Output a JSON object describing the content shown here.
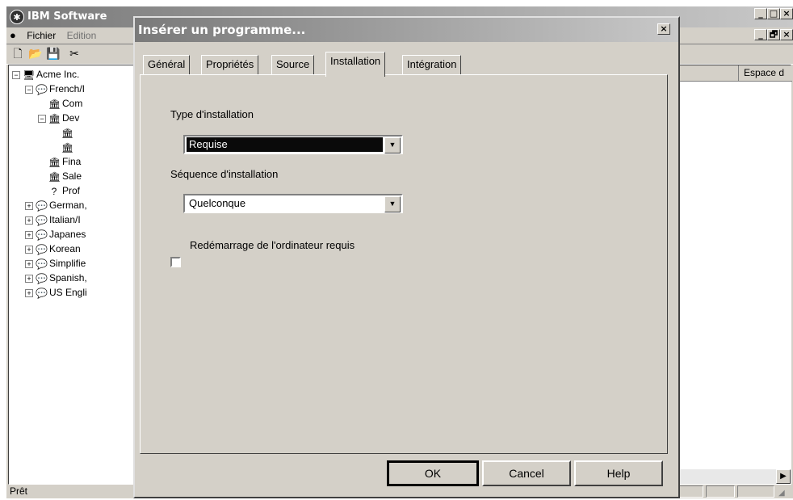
{
  "main_window": {
    "title": "IBM Software",
    "menu": [
      "Fichier",
      "Edition"
    ],
    "toolbar_icons": [
      "new-icon",
      "open-icon",
      "save-icon",
      "cut-icon"
    ],
    "tree": [
      {
        "label": "Acme Inc.",
        "expander": "−"
      },
      {
        "label": "French/I",
        "expander": "−"
      },
      {
        "label": "Com",
        "expander": ""
      },
      {
        "label": "Dev",
        "expander": "−"
      },
      {
        "label": "",
        "expander": ""
      },
      {
        "label": "",
        "expander": ""
      },
      {
        "label": "Fina",
        "expander": ""
      },
      {
        "label": "Sale",
        "expander": ""
      },
      {
        "label": "Prof",
        "expander": ""
      },
      {
        "label": "German,",
        "expander": "+"
      },
      {
        "label": "Italian/I",
        "expander": "+"
      },
      {
        "label": "Japanes",
        "expander": "+"
      },
      {
        "label": "Korean",
        "expander": "+"
      },
      {
        "label": "Simplifie",
        "expander": "+"
      },
      {
        "label": "Spanish,",
        "expander": "+"
      },
      {
        "label": "US Engli",
        "expander": "+"
      }
    ],
    "column_header": "Espace d",
    "status": "Prêt",
    "win_buttons_1": [
      "_",
      "□",
      "×"
    ],
    "win_buttons_2": [
      "_",
      "🗗",
      "×"
    ]
  },
  "dialog": {
    "title": "Insérer un programme...",
    "close": "×",
    "tabs": [
      "Général",
      "Propriétés",
      "Source",
      "Installation",
      "Intégration"
    ],
    "active_tab": "Installation",
    "install_type_label": "Type d'installation",
    "install_type_value": "Requise",
    "install_seq_label": "Séquence d'installation",
    "install_seq_value": "Quelconque",
    "reboot_label": "Redémarrage de l'ordinateur requis",
    "reboot_checked": false,
    "buttons": {
      "ok": "OK",
      "cancel": "Cancel",
      "help": "Help"
    }
  }
}
